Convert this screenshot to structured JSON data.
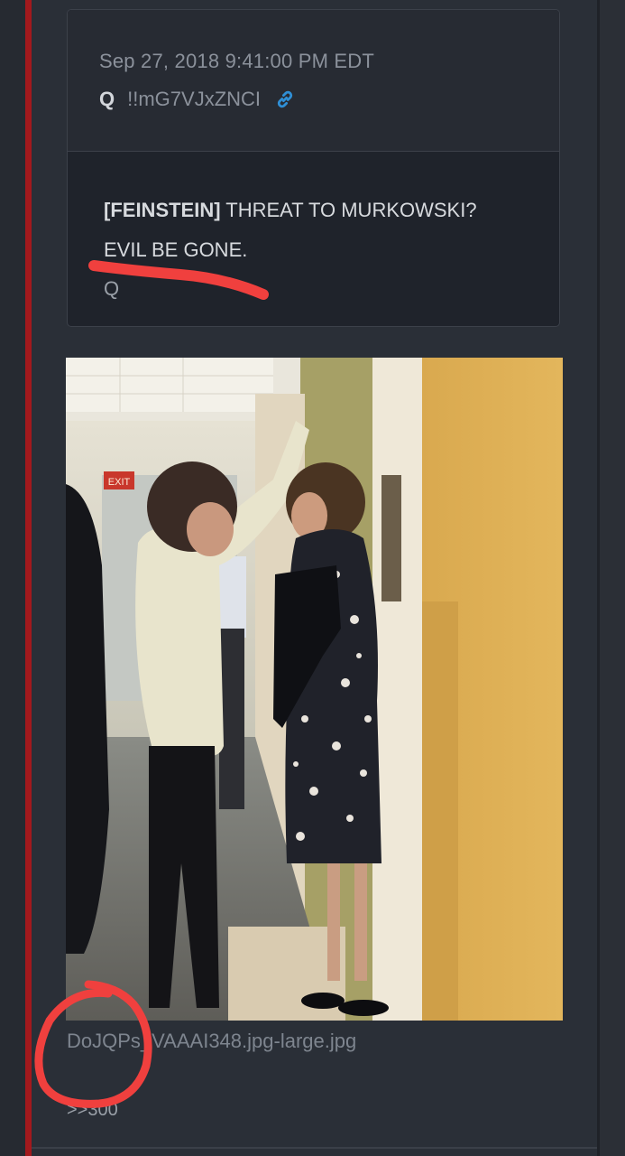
{
  "post": {
    "timestamp": "Sep 27, 2018 9:41:00 PM EDT",
    "author": "Q",
    "tripcode": "!!mG7VJxZNCI",
    "link_icon": "link-icon",
    "body_tag": "[FEINSTEIN]",
    "body_line1_rest": " THREAT TO MURKOWSKI?",
    "body_line2": "EVIL BE GONE.",
    "signature": "Q"
  },
  "attachment": {
    "filename": "DoJQPs_VAAAI348.jpg-large.jpg",
    "exit_sign": "EXIT"
  },
  "reply": {
    "ref": ">>300"
  },
  "colors": {
    "accent_red": "#a3191d",
    "scribble_red": "#f0403e",
    "link_blue": "#2f8fd6",
    "background": "#2a2f37"
  }
}
